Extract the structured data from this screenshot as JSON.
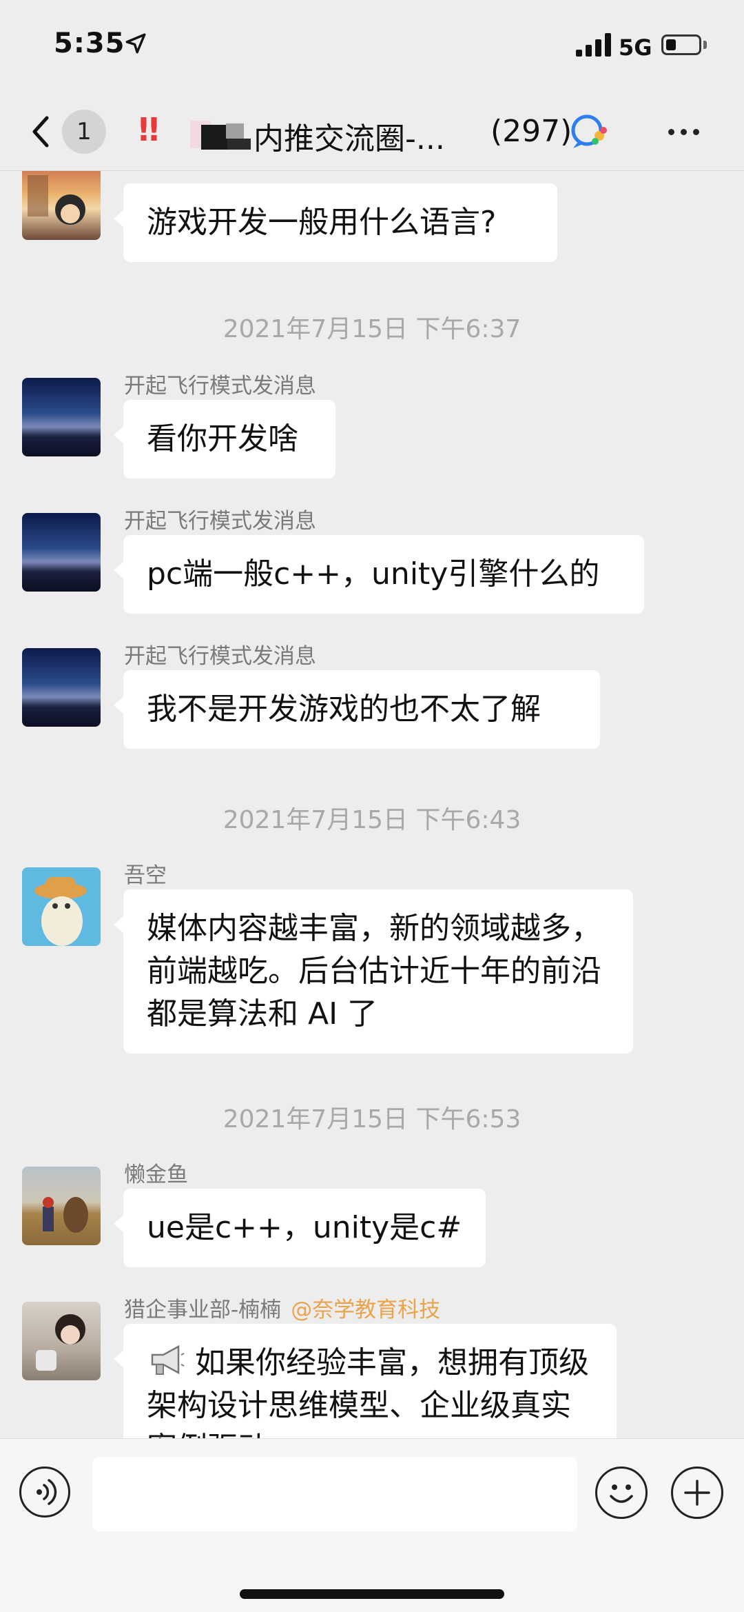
{
  "status_bar": {
    "time": "5:35",
    "network": "5G"
  },
  "nav": {
    "back_icon": "chevron-left-icon",
    "unread_count": "1",
    "alert_icon": "!!",
    "title": "内推交流圈-...",
    "member_count": "(297)",
    "more_icon": "ellipsis-icon"
  },
  "messages": [
    {
      "type": "message",
      "sender": "",
      "text": "游戏开发一般用什么语言?"
    },
    {
      "type": "time",
      "text": "2021年7月15日 下午6:37"
    },
    {
      "type": "message",
      "sender": "开起飞行模式发消息",
      "text": "看你开发啥"
    },
    {
      "type": "message",
      "sender": "开起飞行模式发消息",
      "text": "pc端一般c++，unity引擎什么的"
    },
    {
      "type": "message",
      "sender": "开起飞行模式发消息",
      "text": "我不是开发游戏的也不太了解"
    },
    {
      "type": "time",
      "text": "2021年7月15日 下午6:43"
    },
    {
      "type": "message",
      "sender": "吾空",
      "text": "媒体内容越丰富，新的领域越多，前端越吃。后台估计近十年的前沿都是算法和 AI 了"
    },
    {
      "type": "time",
      "text": "2021年7月15日 下午6:53"
    },
    {
      "type": "message",
      "sender": "懒金鱼",
      "text": "ue是c++，unity是c#"
    },
    {
      "type": "message",
      "sender": "猎企事业部-楠楠",
      "mention": "@奈学教育科技",
      "text": "如果你经验丰富，想拥有顶级架构设计思维模型、企业级真实案例驱动，"
    }
  ],
  "input_bar": {
    "voice_icon": "voice-icon",
    "emoji_icon": "emoji-icon",
    "plus_icon": "plus-icon"
  },
  "colors": {
    "background": "#ededed",
    "bubble": "#ffffff",
    "mention": "#e9a34b",
    "alert": "#e53b3b"
  }
}
